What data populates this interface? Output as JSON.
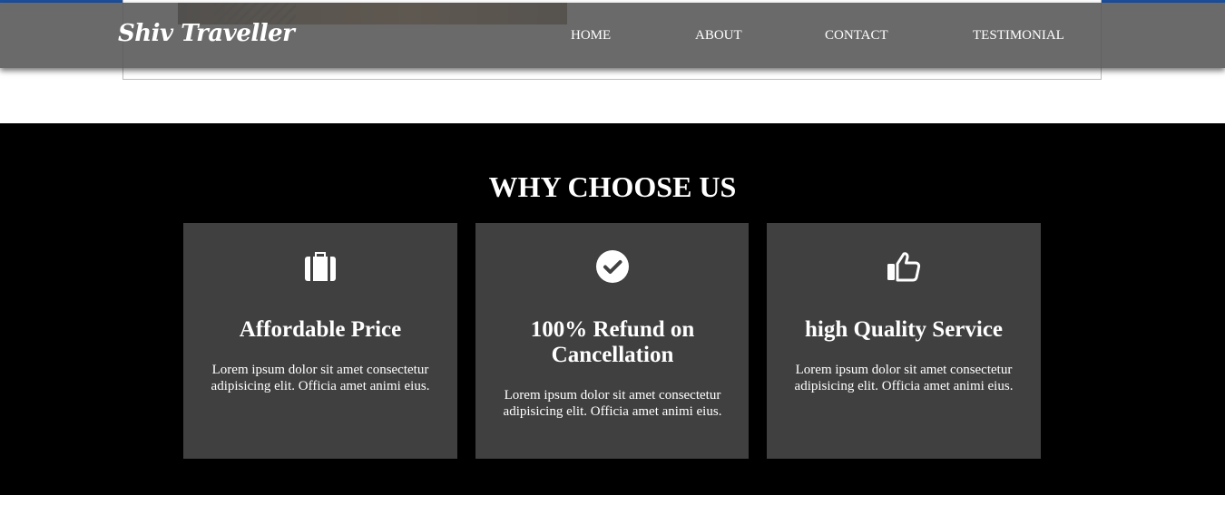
{
  "header": {
    "logo_text": "Shiv Traveller",
    "nav": [
      {
        "label": "HOME"
      },
      {
        "label": "ABOUT"
      },
      {
        "label": "CONTACT"
      },
      {
        "label": "TESTIMONIAL"
      }
    ]
  },
  "why_choose_us": {
    "title": "WHY CHOOSE US",
    "cards": [
      {
        "icon": "suitcase-icon",
        "title": "Affordable Price",
        "text": "Lorem ipsum dolor sit amet consectetur adipisicing elit. Officia amet animi eius."
      },
      {
        "icon": "check-circle-icon",
        "title": "100% Refund on Cancellation",
        "text": "Lorem ipsum dolor sit amet consectetur adipisicing elit. Officia amet animi eius."
      },
      {
        "icon": "thumbs-up-icon",
        "title": "high Quality Service",
        "text": "Lorem ipsum dolor sit amet consectetur adipisicing elit. Officia amet animi eius."
      }
    ]
  },
  "colors": {
    "nav_background": "#555555",
    "section_background": "#000000",
    "card_background": "#404040",
    "top_strip": "#1c4f9c"
  }
}
